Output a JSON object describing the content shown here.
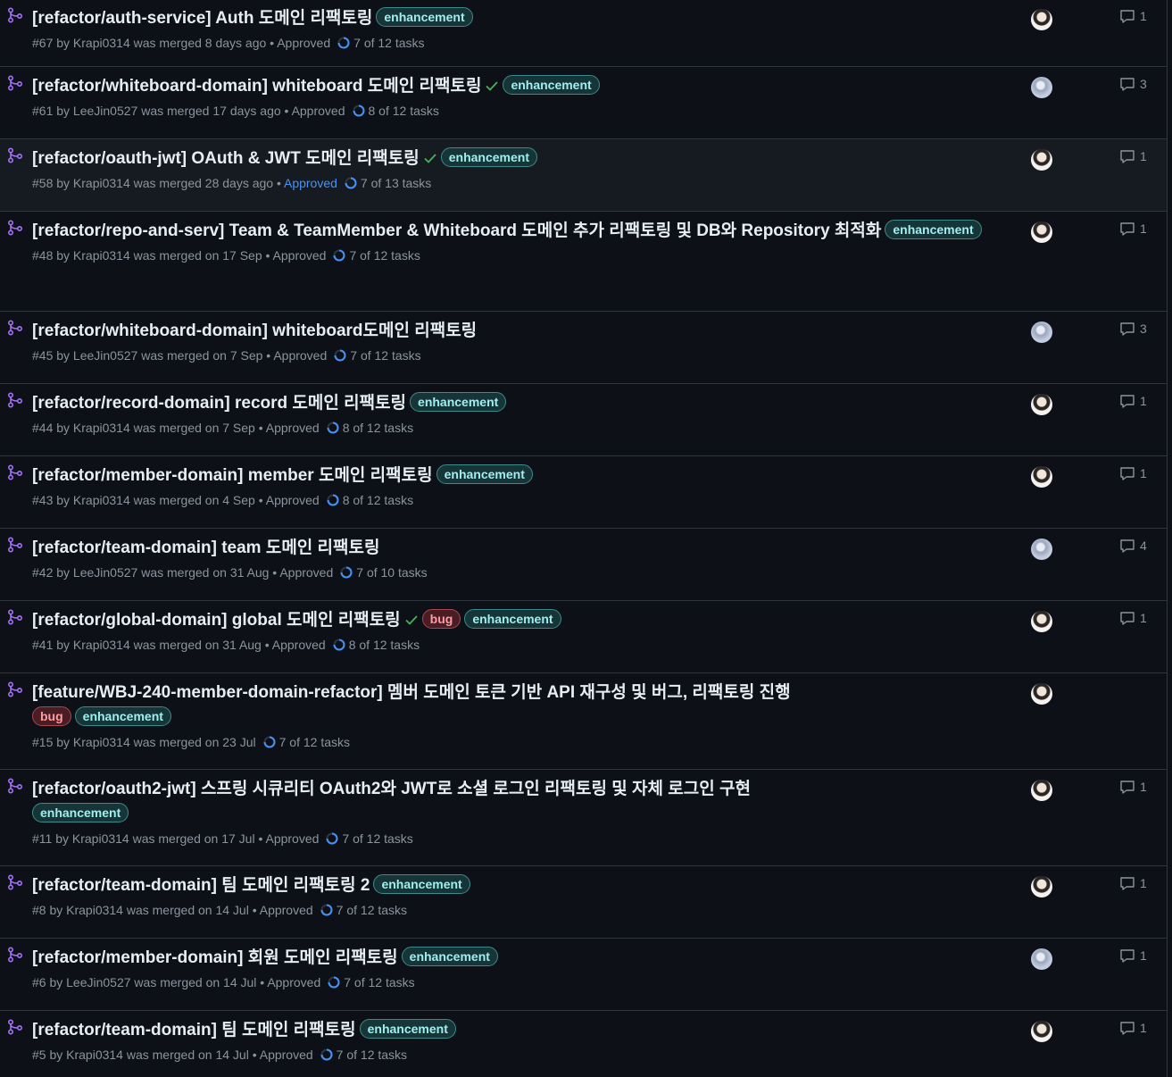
{
  "pull_requests": [
    {
      "title": "[refactor/auth-service] Auth 도메인 리팩토링",
      "check": false,
      "labels_inline": [
        "enhancement"
      ],
      "labels_below": [],
      "meta_prefix": "#67 by Krapi0314 was merged 8 days ago • ",
      "approved": "Approved",
      "approved_link": false,
      "tasks": "7 of 12 tasks",
      "avatar": "k",
      "comments": "1",
      "highlight": false
    },
    {
      "title": "[refactor/whiteboard-domain] whiteboard 도메인 리팩토링",
      "check": true,
      "labels_inline": [
        "enhancement"
      ],
      "labels_below": [],
      "meta_prefix": "#61 by LeeJin0527 was merged 17 days ago • ",
      "approved": "Approved",
      "approved_link": false,
      "tasks": "8 of 12 tasks",
      "avatar": "l",
      "comments": "3",
      "highlight": false
    },
    {
      "title": "[refactor/oauth-jwt] OAuth & JWT 도메인 리팩토링",
      "check": true,
      "labels_inline": [
        "enhancement"
      ],
      "labels_below": [],
      "meta_prefix": "#58 by Krapi0314 was merged 28 days ago • ",
      "approved": "Approved",
      "approved_link": true,
      "tasks": "7 of 13 tasks",
      "avatar": "k",
      "comments": "1",
      "highlight": true
    },
    {
      "title": "[refactor/repo-and-serv] Team & TeamMember & Whiteboard 도메인 추가 리팩토링 및 DB와 Repository 최적화",
      "check": false,
      "labels_inline": [
        "enhancement"
      ],
      "labels_below": [],
      "meta_prefix": "#48 by Krapi0314 was merged on 17 Sep • ",
      "approved": "Approved",
      "approved_link": false,
      "tasks": "7 of 12 tasks",
      "avatar": "k",
      "comments": "1",
      "highlight": false
    },
    {
      "title": "[refactor/whiteboard-domain] whiteboard도메인 리팩토링",
      "check": false,
      "labels_inline": [],
      "labels_below": [],
      "meta_prefix": "#45 by LeeJin0527 was merged on 7 Sep • ",
      "approved": "Approved",
      "approved_link": false,
      "tasks": "7 of 12 tasks",
      "avatar": "l",
      "comments": "3",
      "highlight": false
    },
    {
      "title": "[refactor/record-domain] record 도메인 리팩토링",
      "check": false,
      "labels_inline": [
        "enhancement"
      ],
      "labels_below": [],
      "meta_prefix": "#44 by Krapi0314 was merged on 7 Sep • ",
      "approved": "Approved",
      "approved_link": false,
      "tasks": "8 of 12 tasks",
      "avatar": "k",
      "comments": "1",
      "highlight": false
    },
    {
      "title": "[refactor/member-domain] member 도메인 리팩토링",
      "check": false,
      "labels_inline": [
        "enhancement"
      ],
      "labels_below": [],
      "meta_prefix": "#43 by Krapi0314 was merged on 4 Sep • ",
      "approved": "Approved",
      "approved_link": false,
      "tasks": "8 of 12 tasks",
      "avatar": "k",
      "comments": "1",
      "highlight": false
    },
    {
      "title": "[refactor/team-domain] team 도메인 리팩토링",
      "check": false,
      "labels_inline": [],
      "labels_below": [],
      "meta_prefix": "#42 by LeeJin0527 was merged on 31 Aug • ",
      "approved": "Approved",
      "approved_link": false,
      "tasks": "7 of 10 tasks",
      "avatar": "l",
      "comments": "4",
      "highlight": false
    },
    {
      "title": "[refactor/global-domain] global 도메인 리팩토링",
      "check": true,
      "labels_inline": [
        "bug",
        "enhancement"
      ],
      "labels_below": [],
      "meta_prefix": "#41 by Krapi0314 was merged on 31 Aug • ",
      "approved": "Approved",
      "approved_link": false,
      "tasks": "8 of 12 tasks",
      "avatar": "k",
      "comments": "1",
      "highlight": false
    },
    {
      "title": "[feature/WBJ-240-member-domain-refactor] 멤버 도메인 토큰 기반 API 재구성 및 버그, 리팩토링 진행",
      "check": false,
      "labels_inline": [],
      "labels_below": [
        "bug",
        "enhancement"
      ],
      "meta_prefix": "#15 by Krapi0314 was merged on 23 Jul",
      "approved": "",
      "approved_link": false,
      "tasks": "7 of 12 tasks",
      "avatar": "k",
      "comments": "",
      "highlight": false
    },
    {
      "title": "[refactor/oauth2-jwt] 스프링 시큐리티 OAuth2와 JWT로 소셜 로그인 리팩토링 및 자체 로그인 구현",
      "check": false,
      "labels_inline": [],
      "labels_below": [
        "enhancement"
      ],
      "meta_prefix": "#11 by Krapi0314 was merged on 17 Jul • ",
      "approved": "Approved",
      "approved_link": false,
      "tasks": "7 of 12 tasks",
      "avatar": "k",
      "comments": "1",
      "highlight": false
    },
    {
      "title": "[refactor/team-domain] 팀 도메인 리팩토링 2",
      "check": false,
      "labels_inline": [
        "enhancement"
      ],
      "labels_below": [],
      "meta_prefix": "#8 by Krapi0314 was merged on 14 Jul • ",
      "approved": "Approved",
      "approved_link": false,
      "tasks": "7 of 12 tasks",
      "avatar": "k",
      "comments": "1",
      "highlight": false
    },
    {
      "title": "[refactor/member-domain] 회원 도메인 리팩토링",
      "check": false,
      "labels_inline": [
        "enhancement"
      ],
      "labels_below": [],
      "meta_prefix": "#6 by LeeJin0527 was merged on 14 Jul • ",
      "approved": "Approved",
      "approved_link": false,
      "tasks": "7 of 12 tasks",
      "avatar": "l",
      "comments": "1",
      "highlight": false
    },
    {
      "title": "[refactor/team-domain] 팀 도메인 리팩토링",
      "check": false,
      "labels_inline": [
        "enhancement"
      ],
      "labels_below": [],
      "meta_prefix": "#5 by Krapi0314 was merged on 14 Jul • ",
      "approved": "Approved",
      "approved_link": false,
      "tasks": "7 of 12 tasks",
      "avatar": "k",
      "comments": "1",
      "highlight": false
    }
  ],
  "colors": {
    "merged_icon": "#a371f7",
    "check": "#3fb950",
    "approved_link": "#4493f8",
    "task_progress": "#4493f8"
  },
  "icons": {
    "merged": "git-merge-icon",
    "check": "check-icon",
    "tasks": "progress-circle-icon",
    "comment": "comment-icon"
  }
}
